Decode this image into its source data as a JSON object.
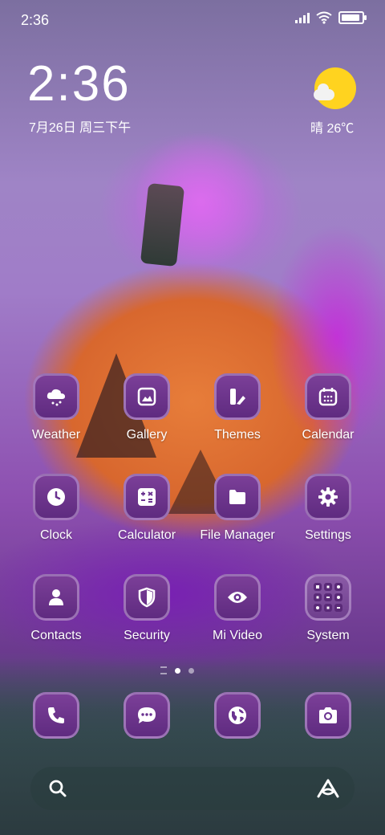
{
  "status_bar": {
    "time": "2:36",
    "icons": [
      "signal-icon",
      "wifi-icon",
      "battery-icon"
    ]
  },
  "clock_widget": {
    "time": "2:36",
    "date": "7月26日 周三下午"
  },
  "weather_widget": {
    "condition_temp": "晴 26℃",
    "icon": "sunny-cloud-icon"
  },
  "apps": [
    {
      "label": "Weather",
      "icon": "cloud-rain-icon"
    },
    {
      "label": "Gallery",
      "icon": "image-icon"
    },
    {
      "label": "Themes",
      "icon": "themes-icon"
    },
    {
      "label": "Calendar",
      "icon": "calendar-icon"
    },
    {
      "label": "Clock",
      "icon": "clock-icon"
    },
    {
      "label": "Calculator",
      "icon": "calculator-icon"
    },
    {
      "label": "File Manager",
      "icon": "folder-icon"
    },
    {
      "label": "Settings",
      "icon": "gear-icon"
    },
    {
      "label": "Contacts",
      "icon": "person-icon"
    },
    {
      "label": "Security",
      "icon": "shield-icon"
    },
    {
      "label": "Mi Video",
      "icon": "eye-icon"
    },
    {
      "label": "System",
      "icon": "folder-grid-icon"
    }
  ],
  "dock": [
    {
      "icon": "phone-icon"
    },
    {
      "icon": "message-icon"
    },
    {
      "icon": "globe-icon"
    },
    {
      "icon": "camera-icon"
    }
  ],
  "pager": {
    "pages": 2,
    "active": 1
  },
  "search_bar": {
    "left_icon": "search-icon",
    "right_icon": "assistant-icon"
  },
  "colors": {
    "icon_bg": "#6d3490",
    "sun": "#ffd31f"
  }
}
